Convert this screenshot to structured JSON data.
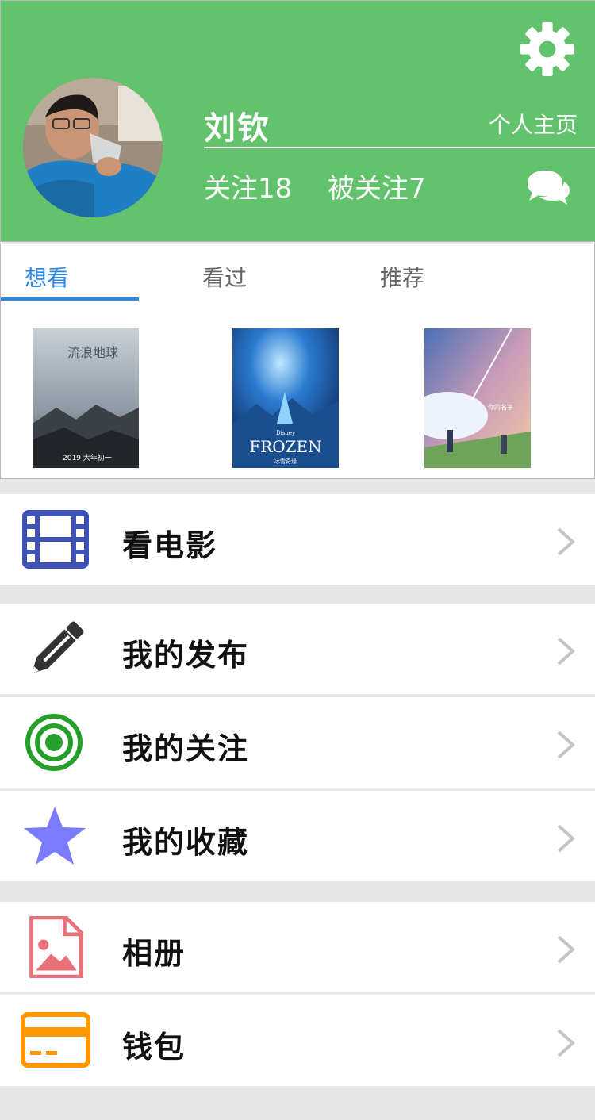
{
  "profile": {
    "name": "刘钦",
    "homepage_link": "个人主页",
    "following": "关注18",
    "followers": "被关注7"
  },
  "tabs": [
    {
      "label": "想看",
      "active": true
    },
    {
      "label": "看过",
      "active": false
    },
    {
      "label": "推荐",
      "active": false
    }
  ],
  "posters": [
    {
      "title_text": "流浪地球",
      "caption": "2019 大年初一"
    },
    {
      "title_text": "FROZEN",
      "brand": "Disney",
      "caption": "冰雪奇缘"
    },
    {
      "title_text": "你的名字",
      "caption": ""
    }
  ],
  "menu": [
    {
      "label": "看电影",
      "icon": "film-icon",
      "color": "#3f51b5"
    },
    {
      "label": "我的发布",
      "icon": "pencil-icon",
      "color": "#333333"
    },
    {
      "label": "我的关注",
      "icon": "target-icon",
      "color": "#26a02a"
    },
    {
      "label": "我的收藏",
      "icon": "star-icon",
      "color": "#7b7bff"
    },
    {
      "label": "相册",
      "icon": "image-file-icon",
      "color": "#e8717a"
    },
    {
      "label": "钱包",
      "icon": "card-icon",
      "color": "#ff9800"
    }
  ],
  "colors": {
    "header_green": "#62c36c",
    "tab_active_blue": "#2d88e6"
  }
}
